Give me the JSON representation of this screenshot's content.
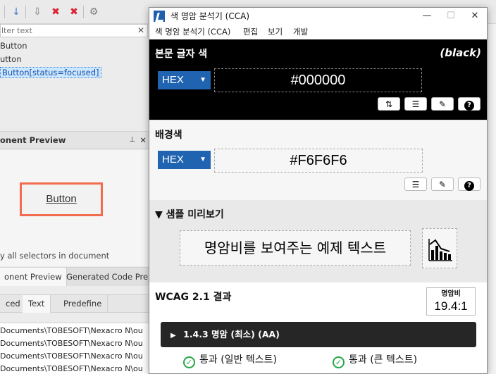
{
  "ide": {
    "filter_placeholder": "lter text",
    "selectors": [
      "Button",
      "utton",
      "Button[status=focused]"
    ],
    "preview_panel_title": "onent Preview",
    "preview_button_label": "Button",
    "preview_note": "y all selectors in document",
    "bottom_tabs": [
      "onent Preview",
      "Generated Code Pre..."
    ],
    "style_tabs": [
      "ced",
      "Text",
      "Predefine"
    ],
    "output_lines": [
      "Documents\\TOBESOFT\\Nexacro N\\ou",
      "Documents\\TOBESOFT\\Nexacro N\\ou",
      "Documents\\TOBESOFT\\Nexacro N\\ou",
      "Documents\\TOBESOFT\\Nexacro N\\ou"
    ],
    "pin_glyph": "📌",
    "close_glyph": "✕",
    "clear_glyph": "✕"
  },
  "cca": {
    "window_title": "색 명암 분석기 (CCA)",
    "window_buttons": [
      "—",
      "☐",
      "✕"
    ],
    "menu": [
      "색 명암 분석기 (CCA)",
      "편집",
      "보기",
      "개발"
    ],
    "foreground": {
      "title": "본문 글자 색",
      "color_name": "(black)",
      "format": "HEX",
      "value": "#000000",
      "buttons": [
        "⇅",
        "☰",
        "✎",
        "?"
      ]
    },
    "background": {
      "title": "배경색",
      "format": "HEX",
      "value": "#F6F6F6",
      "buttons": [
        "☰",
        "✎",
        "?"
      ]
    },
    "sample": {
      "title": "▼ 샘플 미리보기",
      "text": "명암비를 보여주는 예제 텍스트"
    },
    "wcag": {
      "title": "WCAG 2.1 결과",
      "ratio_label": "명암비",
      "ratio_value": "19.4:1",
      "criterion": "1.4.3 명암 (최소) (AA)",
      "criterion_marker": "▶",
      "results": [
        "통과 (일반 텍스트)",
        "통과 (큰 텍스트)"
      ]
    }
  },
  "colors": {
    "accent_blue": "#1f63b1",
    "preview_border": "#f26d4f",
    "pass_green": "#27a745"
  }
}
